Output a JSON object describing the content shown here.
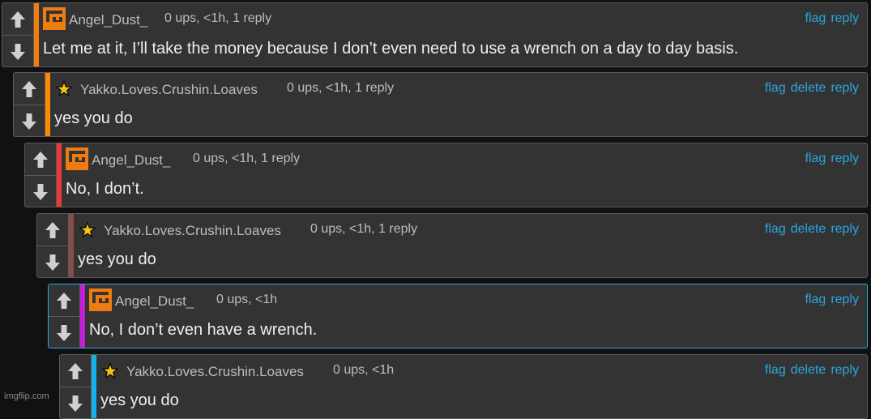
{
  "comments": [
    {
      "username": "Angel_Dust_",
      "avatar": "orange-logo-icon",
      "meta": "0 ups, <1h, 1 reply",
      "text": "Let me at it, I’ll take the money because I don’t even need to use a wrench on a day to day basis.",
      "actions": [
        "flag",
        "reply"
      ],
      "bar_color": "#ef7c11"
    },
    {
      "username": "Yakko.Loves.Crushin.Loaves",
      "avatar": "star-icon",
      "meta": "0 ups, <1h, 1 reply",
      "text": "yes you do",
      "actions": [
        "flag",
        "delete",
        "reply"
      ],
      "bar_color": "#ff8a00"
    },
    {
      "username": "Angel_Dust_",
      "avatar": "orange-logo-icon",
      "meta": "0 ups, <1h, 1 reply",
      "text": "No, I don’t.",
      "actions": [
        "flag",
        "reply"
      ],
      "bar_color": "#e83a3a"
    },
    {
      "username": "Yakko.Loves.Crushin.Loaves",
      "avatar": "star-icon",
      "meta": "0 ups, <1h, 1 reply",
      "text": "yes you do",
      "actions": [
        "flag",
        "delete",
        "reply"
      ],
      "bar_color": "#8a4b4b"
    },
    {
      "username": "Angel_Dust_",
      "avatar": "orange-logo-icon",
      "meta": "0 ups, <1h",
      "text": "No, I don’t even have a wrench.",
      "actions": [
        "flag",
        "reply"
      ],
      "bar_color": "#c21fd6",
      "highlighted": true
    },
    {
      "username": "Yakko.Loves.Crushin.Loaves",
      "avatar": "star-icon",
      "meta": "0 ups, <1h",
      "text": "yes you do",
      "actions": [
        "flag",
        "delete",
        "reply"
      ],
      "bar_color": "#15b4e8"
    }
  ],
  "watermark": "imgflip.com",
  "colors": {
    "link": "#2aa6e0",
    "panel": "#333333",
    "background": "#111111",
    "brand_orange": "#ef7c11"
  }
}
